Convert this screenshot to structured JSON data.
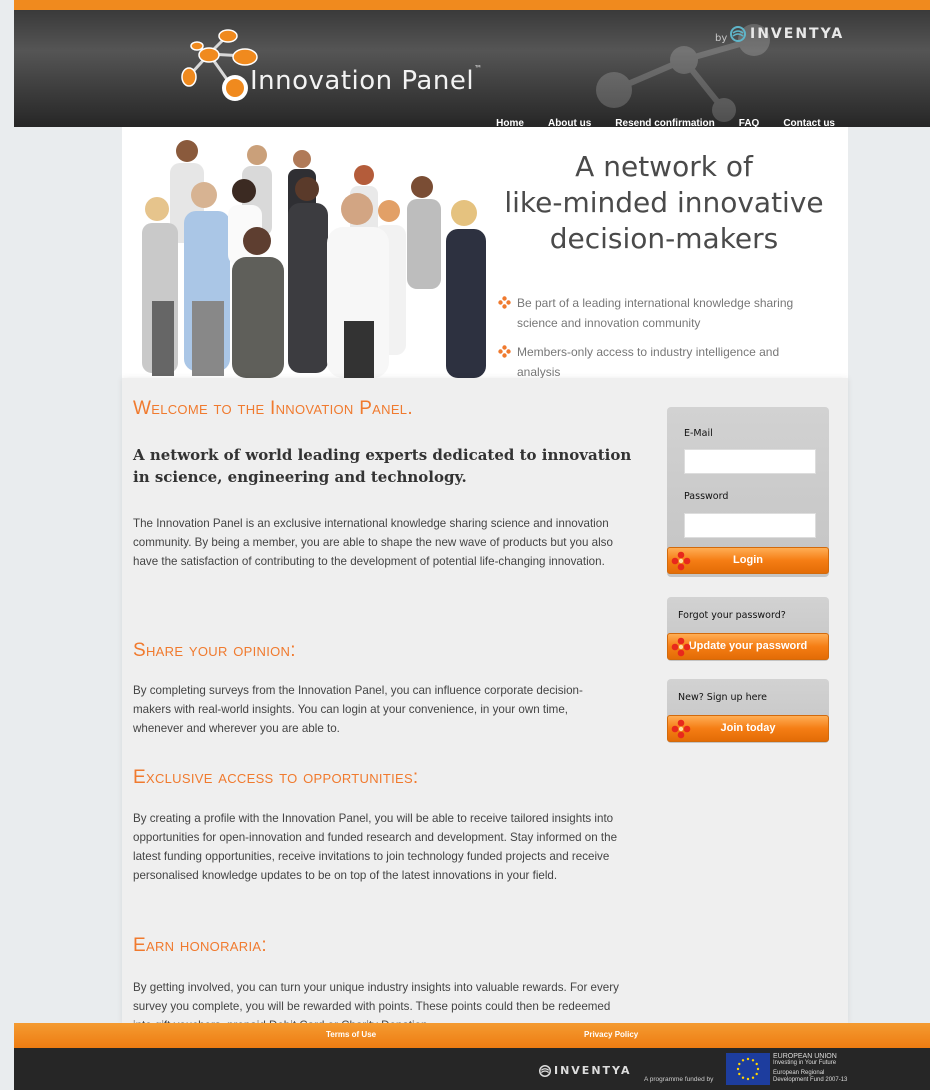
{
  "header": {
    "logo_text": "Innovation Panel",
    "logo_tm": "™",
    "by_label": "by",
    "partner_name": "INVENTYA"
  },
  "nav": {
    "items": [
      "Home",
      "About us",
      "Resend confirmation",
      "FAQ",
      "Contact us"
    ]
  },
  "hero": {
    "title_line1": "A network of",
    "title_line2": "like-minded innovative",
    "title_line3": "decision-makers",
    "bullets": [
      "Be part of a leading international knowledge sharing science and innovation community",
      "Members-only access to industry intelligence and analysis"
    ]
  },
  "main": {
    "welcome_title": "Welcome to the Innovation Panel.",
    "lead": "A network of world leading experts dedicated to innovation in science, engineering and technology.",
    "intro": "The Innovation Panel is an exclusive international knowledge sharing science and innovation community. By being a member, you are able to shape the new wave of products but you also have the satisfaction of contributing to the development of potential life-changing innovation.",
    "share_title": "Share your opinion:",
    "share_text": "By completing surveys from the Innovation Panel, you can influence corporate decision-makers with real-world insights. You can login at your convenience, in your own time, whenever and wherever you are able to.",
    "exclusive_title": "Exclusive access to opportunities:",
    "exclusive_text": "By creating a profile with the Innovation Panel, you will be able to receive tailored insights into opportunities for open-innovation and funded research and development. Stay informed on the latest funding opportunities, receive invitations to join technology funded projects and receive personalised knowledge updates to be on top of the latest innovations in your field.",
    "earn_title": "Earn honoraria:",
    "earn_text": "By getting involved, you can turn your unique industry insights into valuable rewards. For every survey you complete, you will be rewarded with points. These points could then be redeemed into gift vouchers, prepaid Debit Card or Charity Donation."
  },
  "sidebar": {
    "email_label": "E-Mail",
    "email_value": "",
    "password_label": "Password",
    "password_value": "",
    "login_button": "Login",
    "forgot_label": "Forgot your password?",
    "update_button": "Update your password",
    "signup_label": "New? Sign up here",
    "join_button": "Join today"
  },
  "footer": {
    "terms": "Terms of Use",
    "privacy": "Privacy Policy",
    "partner_name": "INVENTYA",
    "funded_label": "A programme funded by",
    "eu_line1": "EUROPEAN UNION",
    "eu_line2": "Investing in Your Future",
    "eu_line3": "European Regional",
    "eu_line4": "Development Fund 2007-13"
  },
  "colors": {
    "accent_orange": "#f07a2e",
    "header_dark": "#2b2b2b",
    "button_orange": "#f57d14"
  }
}
